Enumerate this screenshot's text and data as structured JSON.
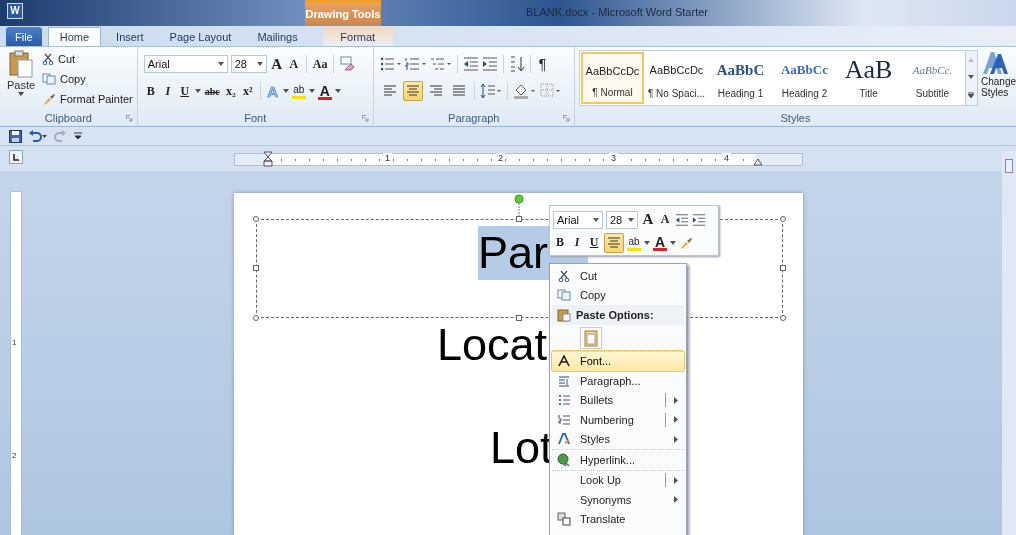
{
  "window": {
    "app_icon": "W",
    "title": "BLANK.docx - Microsoft Word Starter",
    "contextual_group": "Drawing Tools"
  },
  "tabs": [
    {
      "label": "File",
      "kind": "file",
      "selected": false
    },
    {
      "label": "Home",
      "kind": "normal",
      "selected": true
    },
    {
      "label": "Insert",
      "kind": "normal",
      "selected": false
    },
    {
      "label": "Page Layout",
      "kind": "normal",
      "selected": false
    },
    {
      "label": "Mailings",
      "kind": "normal",
      "selected": false
    },
    {
      "label": "Format",
      "kind": "contextual",
      "selected": false
    }
  ],
  "clipboard": {
    "label": "Clipboard",
    "paste": "Paste",
    "cut": "Cut",
    "copy": "Copy",
    "format_painter": "Format Painter"
  },
  "font": {
    "label": "Font",
    "name": "Arial",
    "size": "28",
    "grow": "A",
    "shrink": "A",
    "change_case": "Aa",
    "bold": "B",
    "italic": "I",
    "underline": "U",
    "strikethrough": "abc",
    "subscript": "x₂",
    "superscript": "x²",
    "text_effects": "A",
    "highlight": "ab",
    "font_color": "A"
  },
  "paragraph": {
    "label": "Paragraph",
    "pilcrow": "¶",
    "alignments": [
      {
        "selected": false
      },
      {
        "selected": true
      },
      {
        "selected": false
      },
      {
        "selected": false
      }
    ]
  },
  "styles": {
    "label": "Styles",
    "change_styles": [
      "Change",
      "Styles"
    ],
    "items": [
      {
        "preview": "AaBbCcDc",
        "label": "¶ Normal",
        "kind": "plain",
        "selected": true
      },
      {
        "preview": "AaBbCcDc",
        "label": "¶ No Spaci...",
        "kind": "plain",
        "selected": false
      },
      {
        "preview": "AaBbC",
        "label": "Heading 1",
        "kind": "heading1",
        "selected": false
      },
      {
        "preview": "AaBbCc",
        "label": "Heading 2",
        "kind": "heading2",
        "selected": false
      },
      {
        "preview": "AaB",
        "label": "Title",
        "kind": "title",
        "selected": false
      },
      {
        "preview": "AaBbCc.",
        "label": "Subtitle",
        "kind": "subtitle",
        "selected": false
      }
    ]
  },
  "ruler": {
    "numbers": [
      "1",
      "2",
      "3",
      "4"
    ]
  },
  "vertical_ruler": {
    "numbers": [
      "1",
      "2"
    ]
  },
  "document": {
    "lines": [
      {
        "text": "Par",
        "selected": true
      },
      {
        "text": "Locat",
        "selected": false
      },
      {
        "text": "Lot",
        "selected": false
      }
    ]
  },
  "mini_toolbar": {
    "font": "Arial",
    "size": "28",
    "grow": "A",
    "shrink": "A",
    "bold": "B",
    "italic": "I",
    "underline": "U",
    "highlight": "ab",
    "font_color": "A",
    "center_selected": true
  },
  "context_menu": {
    "items": [
      {
        "label": "Cut",
        "kind": "item",
        "selected": false
      },
      {
        "label": "Copy",
        "kind": "item",
        "selected": false
      },
      {
        "label": "Paste Options:",
        "kind": "header"
      },
      {
        "kind": "paste-option"
      },
      {
        "label": "Font...",
        "kind": "item",
        "selected": true
      },
      {
        "label": "Paragraph...",
        "kind": "item",
        "selected": false
      },
      {
        "label": "Bullets",
        "kind": "split",
        "selected": false
      },
      {
        "label": "Numbering",
        "kind": "split",
        "selected": false
      },
      {
        "label": "Styles",
        "kind": "submenu",
        "selected": false
      },
      {
        "label": "Hyperlink...",
        "kind": "item",
        "selected": false
      },
      {
        "label": "Look Up",
        "kind": "split",
        "selected": false
      },
      {
        "label": "Synonyms",
        "kind": "submenu",
        "selected": false
      },
      {
        "label": "Translate",
        "kind": "item",
        "selected": false
      }
    ]
  }
}
